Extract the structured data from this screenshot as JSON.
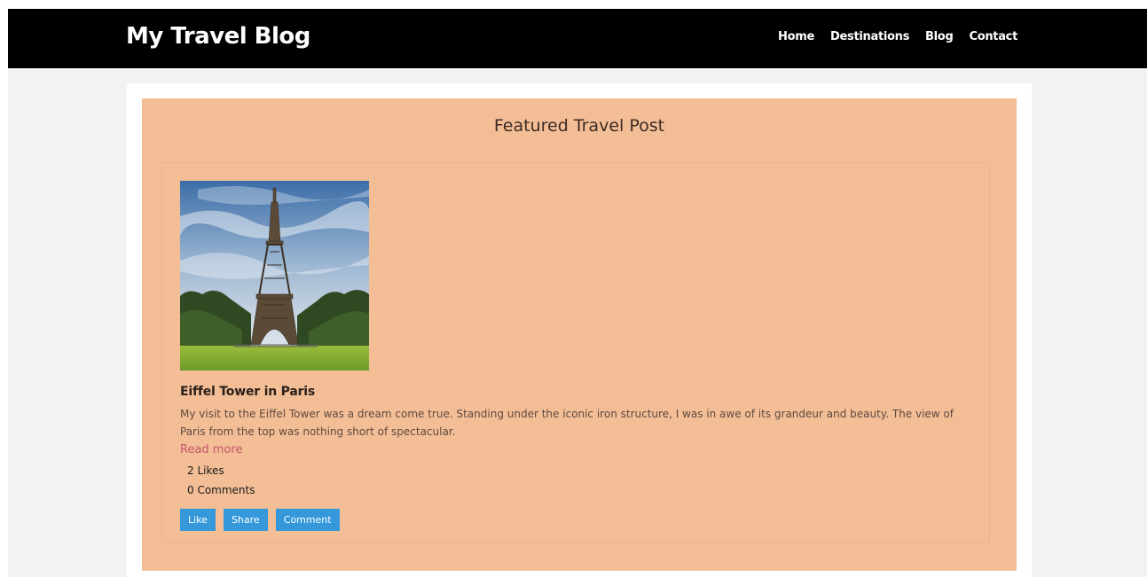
{
  "header": {
    "brand": "My Travel Blog",
    "nav": [
      {
        "label": "Home"
      },
      {
        "label": "Destinations"
      },
      {
        "label": "Blog"
      },
      {
        "label": "Contact"
      }
    ]
  },
  "featured": {
    "section_title": "Featured Travel Post",
    "post": {
      "image_alt": "Eiffel Tower",
      "title": "Eiffel Tower in Paris",
      "excerpt": "My visit to the Eiffel Tower was a dream come true. Standing under the iconic iron structure, I was in awe of its grandeur and beauty. The view of Paris from the top was nothing short of spectacular.",
      "read_more": "Read more",
      "likes": "2 Likes",
      "comments": "0 Comments",
      "actions": {
        "like": "Like",
        "share": "Share",
        "comment": "Comment"
      }
    }
  },
  "colors": {
    "navbar_bg": "#000000",
    "featured_bg": "#f3be96",
    "button_bg": "#3498db",
    "link": "#c2566a"
  }
}
